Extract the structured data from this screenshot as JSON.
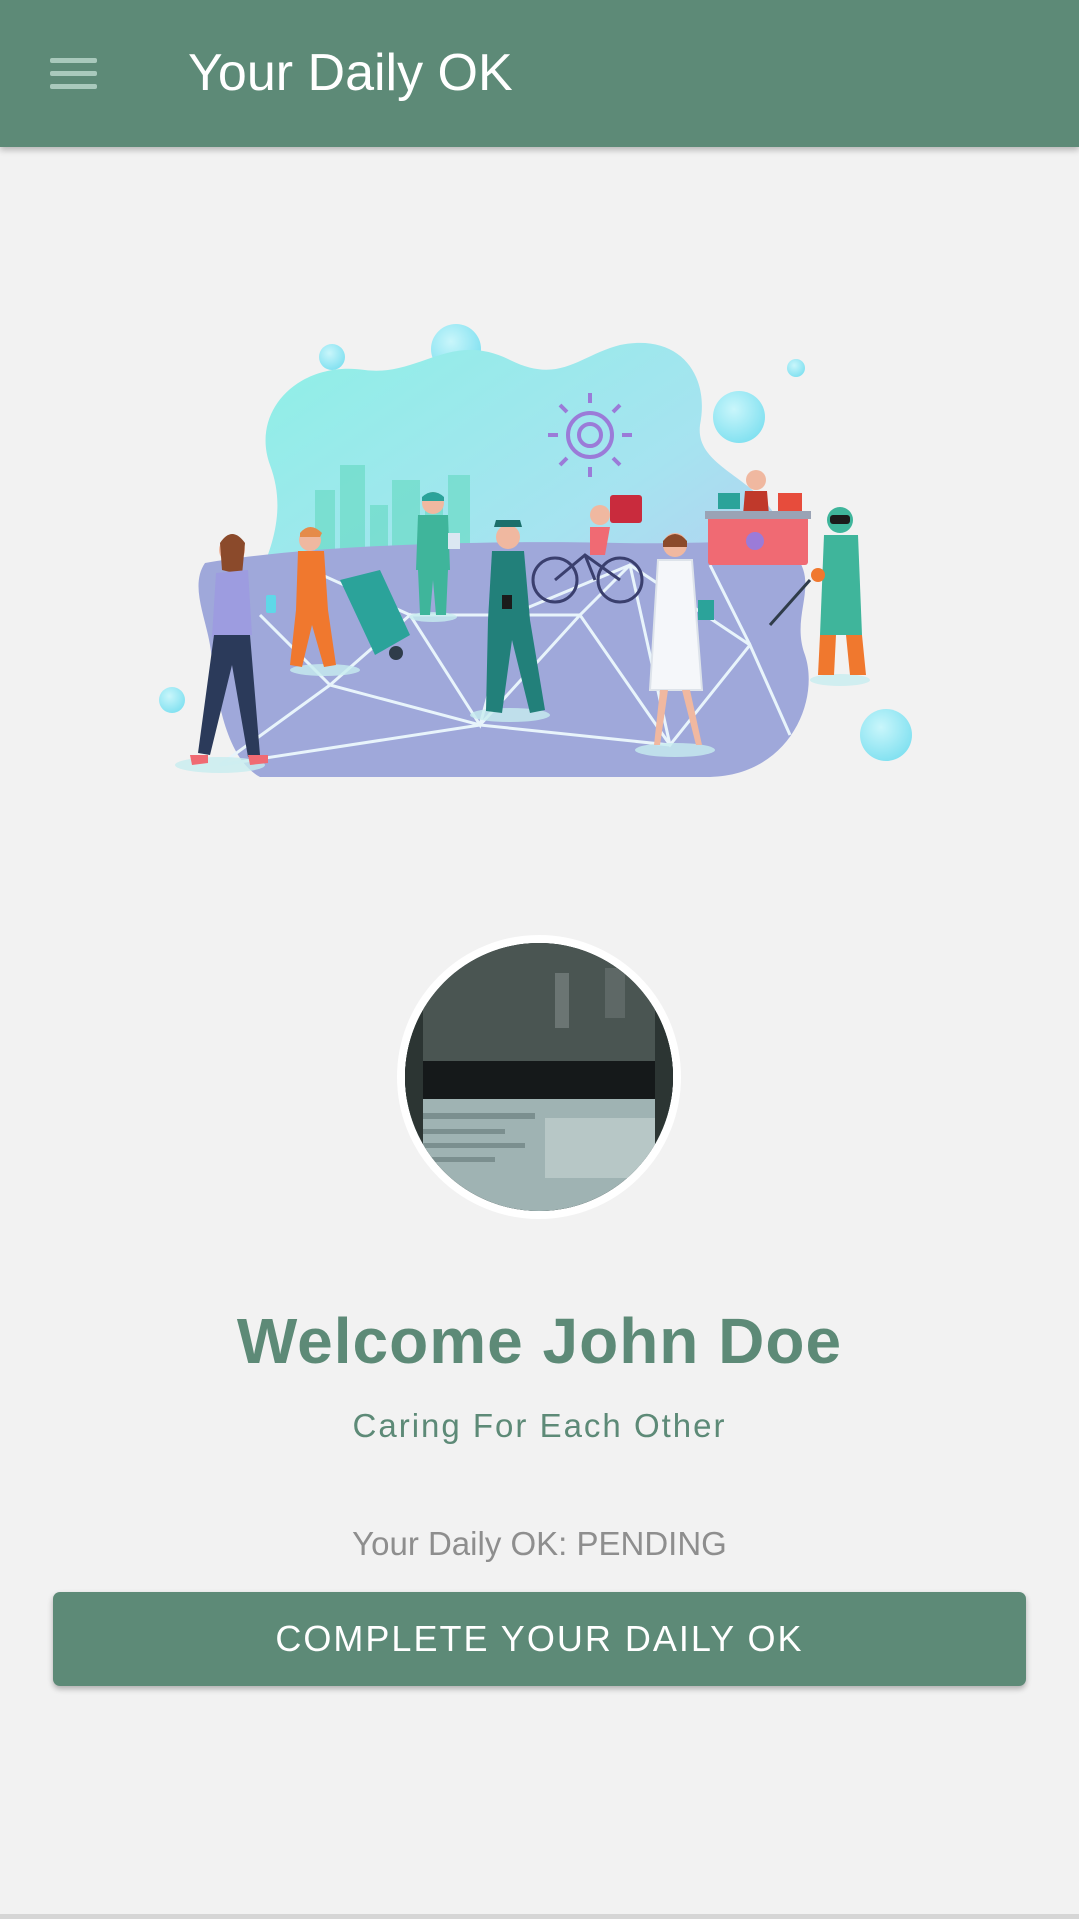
{
  "appbar": {
    "title": "Your Daily OK",
    "menu_icon": "hamburger-menu-icon",
    "background": "#5d8a77"
  },
  "hero": {
    "illustration": "essential-workers-illustration"
  },
  "profile": {
    "avatar_icon": "user-avatar-photo",
    "welcome_text": "Welcome John Doe",
    "tagline": "Caring For Each Other"
  },
  "status": {
    "text": "Your Daily OK: PENDING"
  },
  "actions": {
    "complete_label": "COMPLETE YOUR DAILY OK"
  },
  "colors": {
    "brand": "#5d8a77",
    "background": "#f2f2f2",
    "muted_text": "#8e8e8e"
  }
}
